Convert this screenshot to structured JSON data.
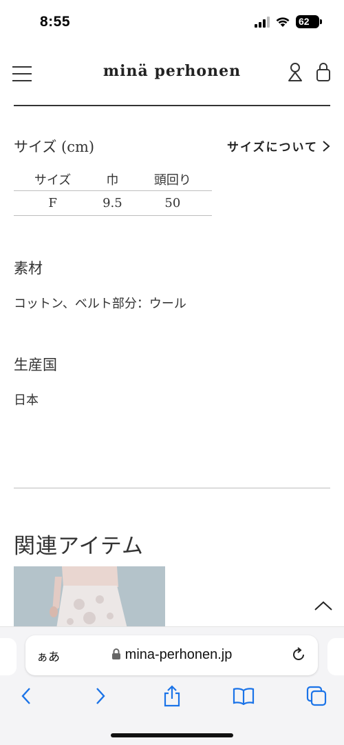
{
  "status_bar": {
    "time": "8:55",
    "battery": "62"
  },
  "header": {
    "brand": "minä perhonen"
  },
  "size_section": {
    "title": "サイズ (cm)",
    "link_label": "サイズについて",
    "table": {
      "headers": [
        "サイズ",
        "巾",
        "頭回り"
      ],
      "rows": [
        [
          "F",
          "9.5",
          "50"
        ]
      ]
    }
  },
  "material": {
    "title": "素材",
    "value": "コットン、ベルト部分：ウール"
  },
  "origin": {
    "title": "生産国",
    "value": "日本"
  },
  "related": {
    "title": "関連アイテム"
  },
  "browser": {
    "aa_label": "ぁあ",
    "url": "mina-perhonen.jp",
    "accent_color": "#1a73e8"
  }
}
